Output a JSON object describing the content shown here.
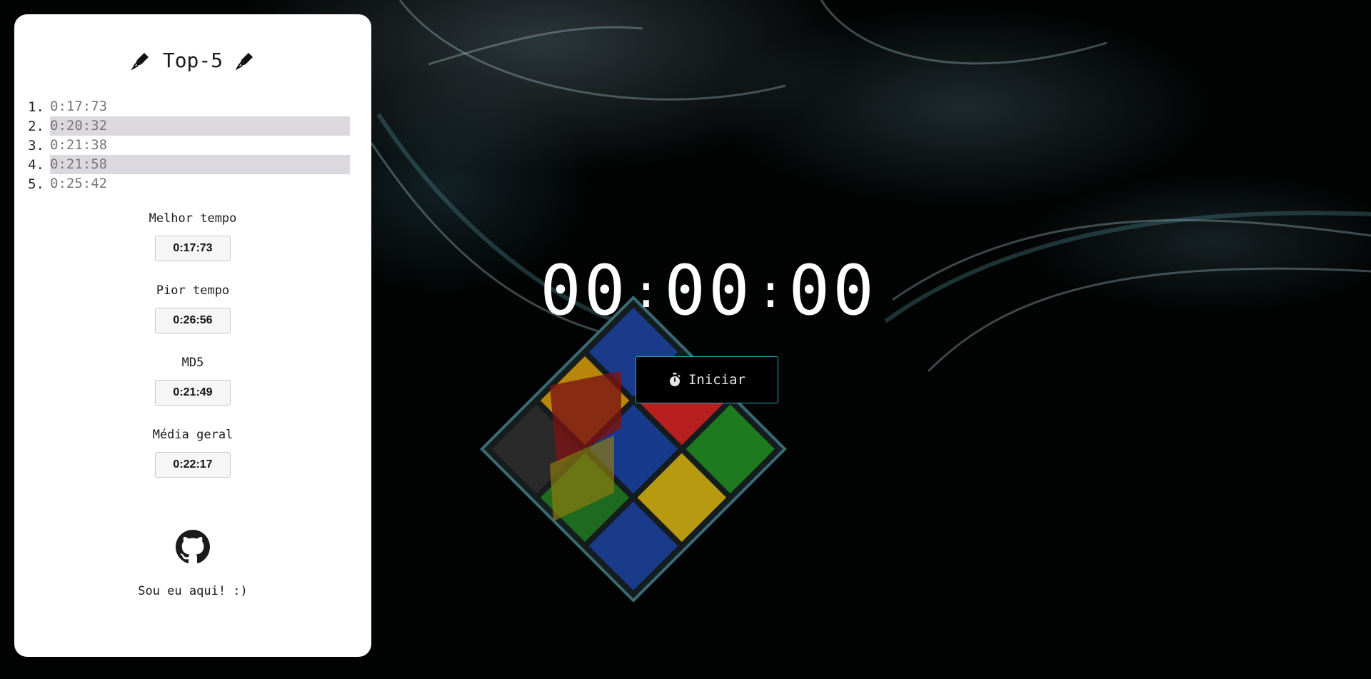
{
  "panel": {
    "title": "Top-5",
    "top_times": [
      {
        "rank": "1.",
        "time": "0:17:73"
      },
      {
        "rank": "2.",
        "time": "0:20:32"
      },
      {
        "rank": "3.",
        "time": "0:21:38"
      },
      {
        "rank": "4.",
        "time": "0:21:58"
      },
      {
        "rank": "5.",
        "time": "0:25:42"
      }
    ],
    "best": {
      "label": "Melhor tempo",
      "value": "0:17:73"
    },
    "worst": {
      "label": "Pior tempo",
      "value": "0:26:56"
    },
    "md5": {
      "label": "MD5",
      "value": "0:21:49"
    },
    "average": {
      "label": "Média geral",
      "value": "0:22:17"
    },
    "github_icon": "github-icon",
    "me_text": "Sou eu aqui! :)"
  },
  "timer": {
    "minutes": "00",
    "seconds": "00",
    "centiseconds": "00",
    "separator": ":"
  },
  "start_button": {
    "label": "Iniciar",
    "icon": "stopwatch-icon",
    "border_color": "#2aa8b8"
  },
  "colors": {
    "panel_bg": "#ffffff",
    "row_highlight": "#dcd9de",
    "page_bg": "#000000"
  }
}
